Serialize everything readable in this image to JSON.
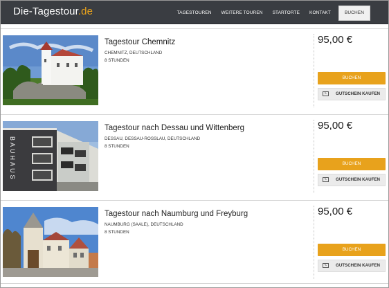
{
  "header": {
    "logo_main": "Die-Tagestour",
    "logo_tld": ".de",
    "nav": [
      "TAGESTOUREN",
      "WEITERE TOUREN",
      "STARTORTE",
      "KONTAKT"
    ],
    "nav_active": "BUCHEN"
  },
  "colors": {
    "accent": "#e8a21c",
    "header_bg": "#3a3d42"
  },
  "listings": [
    {
      "title": "Tagestour Chemnitz",
      "location": "CHEMNITZ, DEUTSCHLAND",
      "duration": "8 STUNDEN",
      "price": "95,00 €",
      "book_label": "BUCHEN",
      "voucher_label": "GUTSCHEIN KAUFEN"
    },
    {
      "title": "Tagestour nach Dessau und Wittenberg",
      "location": "DESSAU, DESSAU-ROSSLAU, DEUTSCHLAND",
      "duration": "8 STUNDEN",
      "price": "95,00 €",
      "book_label": "BUCHEN",
      "voucher_label": "GUTSCHEIN KAUFEN",
      "image_text": "BAUHAUS"
    },
    {
      "title": "Tagestour nach Naumburg und Freyburg",
      "location": "NAUMBURG (SAALE), DEUTSCHLAND",
      "duration": "8 STUNDEN",
      "price": "95,00 €",
      "book_label": "BUCHEN",
      "voucher_label": "GUTSCHEIN KAUFEN"
    }
  ]
}
